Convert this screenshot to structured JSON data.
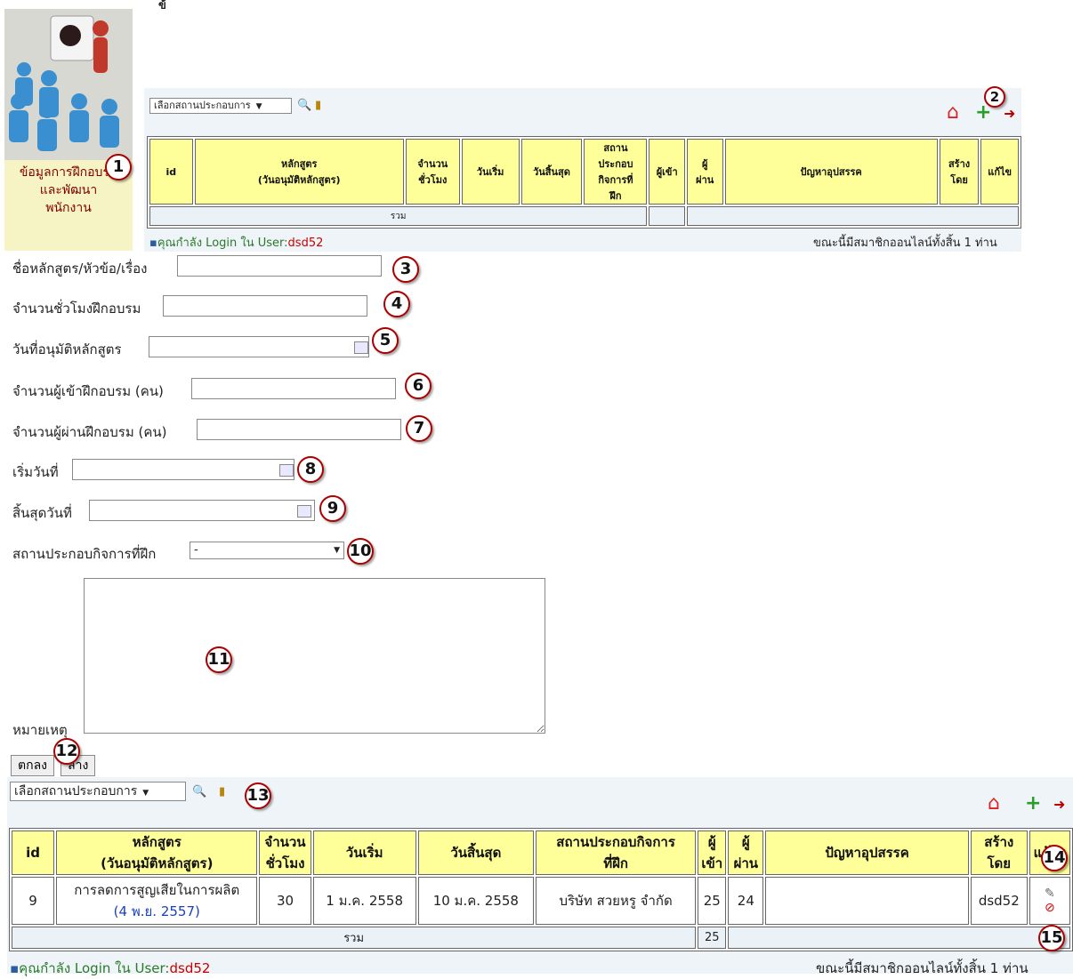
{
  "left_panel": {
    "caption_line1": "ข้อมูลการฝึกอบรม",
    "caption_line2": "และพัฒนา",
    "caption_line3": "พนักงาน",
    "image_icon": "training-presentation-illustration"
  },
  "top_section": {
    "select_label": "เลือกสถานประกอบการ",
    "columns": [
      "id",
      "หลักสูตร\n(วันอนุมัติหลักสูตร)",
      "จำนวน\nชั่วโมง",
      "วันเริ่ม",
      "วันสิ้นสุด",
      "สถาน\nประกอบ\nกิจการที่\nฝึก",
      "ผู้เข้า",
      "ผู้\nผ่าน",
      "ปัญหาอุปสรรค",
      "สร้าง\nโดย",
      "แก้ไข"
    ],
    "total_label": "รวม",
    "login_prefix": "คุณกำลัง Login ใน User:",
    "login_user": "dsd52",
    "online_text": "ขณะนี้มีสมาชิกออนไลน์ทั้งสิ้น 1 ท่าน"
  },
  "form": {
    "course_name_label": "ชื่อหลักสูตร/หัวข้อ/เรื่อง",
    "hours_label": "จำนวนชั่วโมงฝึกอบรม",
    "approve_date_label": "วันที่อนุมัติหลักสูตร",
    "attendees_label": "จำนวนผู้เข้าฝึกอบรม (คน)",
    "passed_label": "จำนวนผู้ผ่านฝึกอบรม (คน)",
    "start_label": "เริ่มวันที่",
    "end_label": "สิ้นสุดวันที่",
    "workplace_label": "สถานประกอบกิจการที่ฝึก",
    "workplace_value": "-",
    "remark_label": "หมายเหตุ",
    "ok_button": "ตกลง",
    "clear_button": "ล้าง"
  },
  "bottom_section": {
    "select_label": "เลือกสถานประกอบการ",
    "columns": [
      "id",
      "หลักสูตร\n(วันอนุมัติหลักสูตร)",
      "จำนวน\nชั่วโมง",
      "วันเริ่ม",
      "วันสิ้นสุด",
      "สถานประกอบกิจการ\nที่ฝึก",
      "ผู้\nเข้า",
      "ผู้\nผ่าน",
      "ปัญหาอุปสรรค",
      "สร้าง\nโดย",
      "แก้ไข"
    ],
    "rows": [
      {
        "id": "9",
        "course": "การลดการสูญเสียในการผลิต",
        "approved": "(4 พ.ย. 2557)",
        "hours": "30",
        "start": "1 ม.ค. 2558",
        "end": "10 ม.ค. 2558",
        "workplace": "บริษัท สวยหรู จำกัด",
        "attendees": "25",
        "passed": "24",
        "problems": "",
        "created_by": "dsd52"
      }
    ],
    "total_label": "รวม",
    "total_attendees": "25",
    "login_prefix": "คุณกำลัง Login ใน User:",
    "login_user": "dsd52",
    "online_text": "ขณะนี้มีสมาชิกออนไลน์ทั้งสิ้น 1 ท่าน"
  },
  "markers": [
    "1",
    "2",
    "3",
    "4",
    "5",
    "6",
    "7",
    "8",
    "9",
    "10",
    "11",
    "12",
    "13",
    "14",
    "15"
  ]
}
